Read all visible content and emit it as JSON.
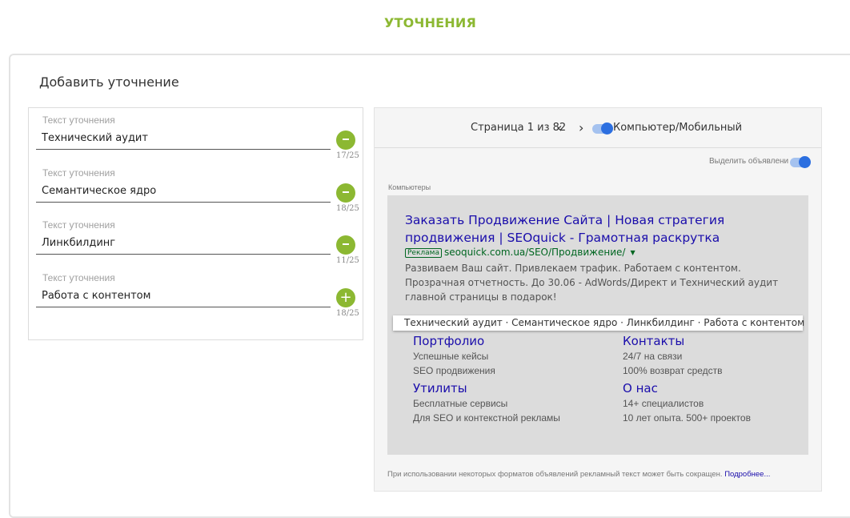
{
  "page": {
    "heading": "УТОЧНЕНИЯ"
  },
  "card": {
    "title": "Добавить уточнение"
  },
  "fields": [
    {
      "label": "Текст уточнения",
      "value": "Технический аудит",
      "counter": "17/25",
      "action": "remove"
    },
    {
      "label": "Текст уточнения",
      "value": "Семантическое ядро",
      "counter": "18/25",
      "action": "remove"
    },
    {
      "label": "Текст уточнения",
      "value": "Линкбилдинг",
      "counter": "11/25",
      "action": "remove"
    },
    {
      "label": "Текст уточнения",
      "value": "Работа с контентом",
      "counter": "18/25",
      "action": "add"
    }
  ],
  "preview": {
    "pager": {
      "text": "Страница 1 из 82",
      "prev": "‹",
      "next": "›"
    },
    "device_toggle_label": "Компьютер/Мобильный",
    "highlight_label": "Выделить объявлени",
    "section_label": "Компьютеры",
    "ad": {
      "title": "Заказать Продвижение Сайта | Новая стратегия продвижения | SEOquick - Грамотная раскрутка",
      "badge": "Реклама",
      "url": "seoquick.com.ua/SEO/Продвижение/",
      "caret": "▼",
      "description": "Развиваем Ваш сайт. Привлекаем трафик. Работаем с контентом. Прозрачная отчетность. До 30.06 - AdWords/Директ и Технический аудит главной страницы в подарок!",
      "callouts": "Технический аудит · Семантическое ядро · Линкбилдинг · Работа с контентом",
      "sitelinks": [
        {
          "title": "Портфолио",
          "line1": "Успешные кейсы",
          "line2": "SEO продвижения"
        },
        {
          "title": "Контакты",
          "line1": "24/7 на связи",
          "line2": "100% возврат средств"
        },
        {
          "title": "Утилиты",
          "line1": "Бесплатные сервисы",
          "line2": "Для SEO и контекстной рекламы"
        },
        {
          "title": "О нас",
          "line1": "14+ специалистов",
          "line2": "10 лет опыта. 500+ проектов"
        }
      ]
    },
    "footnote": "При использовании некоторых форматов объявлений рекламный текст может быть сокращен.",
    "footnote_link": "Подробнее..."
  },
  "colors": {
    "accent": "#8cb832",
    "toggle": "#2c6fe0",
    "link": "#1a0dab",
    "url": "#006621"
  }
}
